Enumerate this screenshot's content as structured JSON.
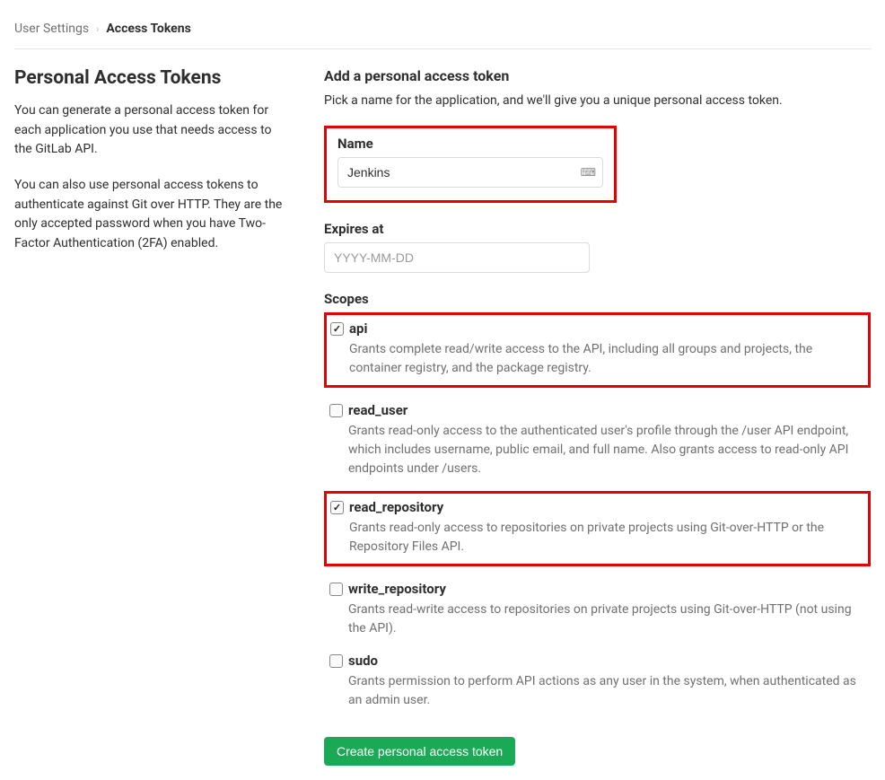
{
  "breadcrumb": {
    "parent": "User Settings",
    "current": "Access Tokens"
  },
  "sidebar": {
    "title": "Personal Access Tokens",
    "p1": "You can generate a personal access token for each application you use that needs access to the GitLab API.",
    "p2": "You can also use personal access tokens to authenticate against Git over HTTP. They are the only accepted password when you have Two-Factor Authentication (2FA) enabled."
  },
  "form": {
    "heading": "Add a personal access token",
    "subheading": "Pick a name for the application, and we'll give you a unique personal access token.",
    "name_label": "Name",
    "name_value": "Jenkins",
    "expires_label": "Expires at",
    "expires_placeholder": "YYYY-MM-DD",
    "scopes_label": "Scopes",
    "scopes": [
      {
        "name": "api",
        "desc": "Grants complete read/write access to the API, including all groups and projects, the container registry, and the package registry.",
        "checked": true,
        "highlight": true
      },
      {
        "name": "read_user",
        "desc": "Grants read-only access to the authenticated user's profile through the /user API endpoint, which includes username, public email, and full name. Also grants access to read-only API endpoints under /users.",
        "checked": false,
        "highlight": false
      },
      {
        "name": "read_repository",
        "desc": "Grants read-only access to repositories on private projects using Git-over-HTTP or the Repository Files API.",
        "checked": true,
        "highlight": true
      },
      {
        "name": "write_repository",
        "desc": "Grants read-write access to repositories on private projects using Git-over-HTTP (not using the API).",
        "checked": false,
        "highlight": false
      },
      {
        "name": "sudo",
        "desc": "Grants permission to perform API actions as any user in the system, when authenticated as an admin user.",
        "checked": false,
        "highlight": false
      }
    ],
    "submit_label": "Create personal access token"
  }
}
